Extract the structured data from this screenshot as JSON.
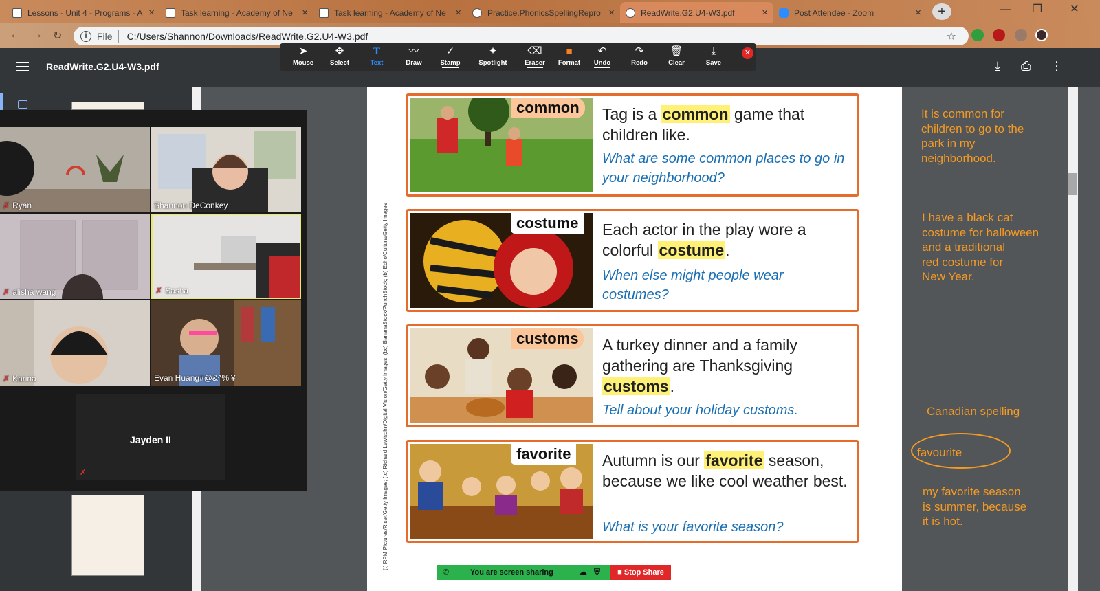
{
  "browser": {
    "tabs": [
      {
        "title": "Lessons - Unit 4 - Programs - A",
        "close": "×"
      },
      {
        "title": "Task learning - Academy of Ne",
        "close": "×"
      },
      {
        "title": "Task learning - Academy of Ne",
        "close": "×"
      },
      {
        "title": "Practice.PhonicsSpellingRepro",
        "close": "×"
      },
      {
        "title": "ReadWrite.G2.U4-W3.pdf",
        "close": "×"
      },
      {
        "title": "Post Attendee - Zoom",
        "close": "×"
      }
    ],
    "new_tab": "+",
    "window_buttons": [
      "—",
      "❐",
      "✕"
    ],
    "nav": {
      "back": "←",
      "forward": "→",
      "reload": "↻"
    },
    "address": {
      "scheme_label": "File",
      "url": "C:/Users/Shannon/Downloads/ReadWrite.G2.U4-W3.pdf",
      "info": "i",
      "star": "☆"
    }
  },
  "pdf_viewer": {
    "title": "ReadWrite.G2.U4-W3.pdf",
    "download": "⤓",
    "print": "⎙",
    "more": "⋮"
  },
  "annotate": {
    "tools": [
      {
        "label": "Mouse",
        "icon": "➤"
      },
      {
        "label": "Select",
        "icon": "✥"
      },
      {
        "label": "Text",
        "icon": "T"
      },
      {
        "label": "Draw",
        "icon": "〰"
      },
      {
        "label": "Stamp",
        "icon": "✓"
      },
      {
        "label": "Spotlight",
        "icon": "✦"
      },
      {
        "label": "Eraser",
        "icon": "⌫"
      },
      {
        "label": "Format",
        "icon": "■"
      },
      {
        "label": "Undo",
        "icon": "↶"
      },
      {
        "label": "Redo",
        "icon": "↷"
      },
      {
        "label": "Clear",
        "icon": "🗑"
      },
      {
        "label": "Save",
        "icon": "⤓"
      }
    ],
    "close": "✕",
    "format_color": "#f5821f"
  },
  "zoom_gallery": {
    "participants": [
      {
        "name": "Ryan"
      },
      {
        "name": "Shannon DeConkey"
      },
      {
        "name": "alisha wang"
      },
      {
        "name": "Sasha"
      },
      {
        "name": "Karina"
      },
      {
        "name": "Evan Huang#@&^%￥"
      }
    ],
    "audio_only": {
      "name": "Jayden II"
    },
    "muted_icon": "✗"
  },
  "document": {
    "credit": "(t) RPM Pictures/Riser/Getty Images; (tc) Richard Lewisohn/Digital Vision/Getty Images; (bc) BananaStock/PunchStock; (b) Echo/Cultura/Getty Images",
    "cards": [
      {
        "word": "common",
        "sentence_before": "Tag is a ",
        "sentence_bold": "common",
        "sentence_after": " game that children like.",
        "question": "What are some common places to go in your neighborhood?"
      },
      {
        "word": "costume",
        "sentence_before": "Each actor in the play wore a colorful ",
        "sentence_bold": "costume",
        "sentence_after": ".",
        "question": "When else might people wear costumes?"
      },
      {
        "word": "customs",
        "sentence_before": "A turkey dinner and a family gathering are Thanksgiving ",
        "sentence_bold": "customs",
        "sentence_after": ".",
        "question": "Tell about your holiday customs."
      },
      {
        "word": "favorite",
        "sentence_before": "Autumn is our ",
        "sentence_bold": "favorite",
        "sentence_after": " season, because we like cool weather best.",
        "question": "What is your favorite season?"
      }
    ],
    "card_border_color": "#e56c2a",
    "highlight_color": "#fff176",
    "question_color": "#1a6fb3"
  },
  "notes": {
    "color": "#f59a23",
    "n1": [
      "It is common for",
      "children to go to the",
      "park in my",
      "neighborhood."
    ],
    "n2": [
      "I have a black cat",
      "costume for halloween",
      "and a traditional",
      "red costume for",
      "New Year."
    ],
    "n3": "Canadian spelling",
    "n4": "favourite",
    "n5": [
      "my favorite season",
      "is summer, because",
      "it is hot."
    ]
  },
  "sharing": {
    "status": "You are screen sharing",
    "stop": "Stop Share"
  }
}
